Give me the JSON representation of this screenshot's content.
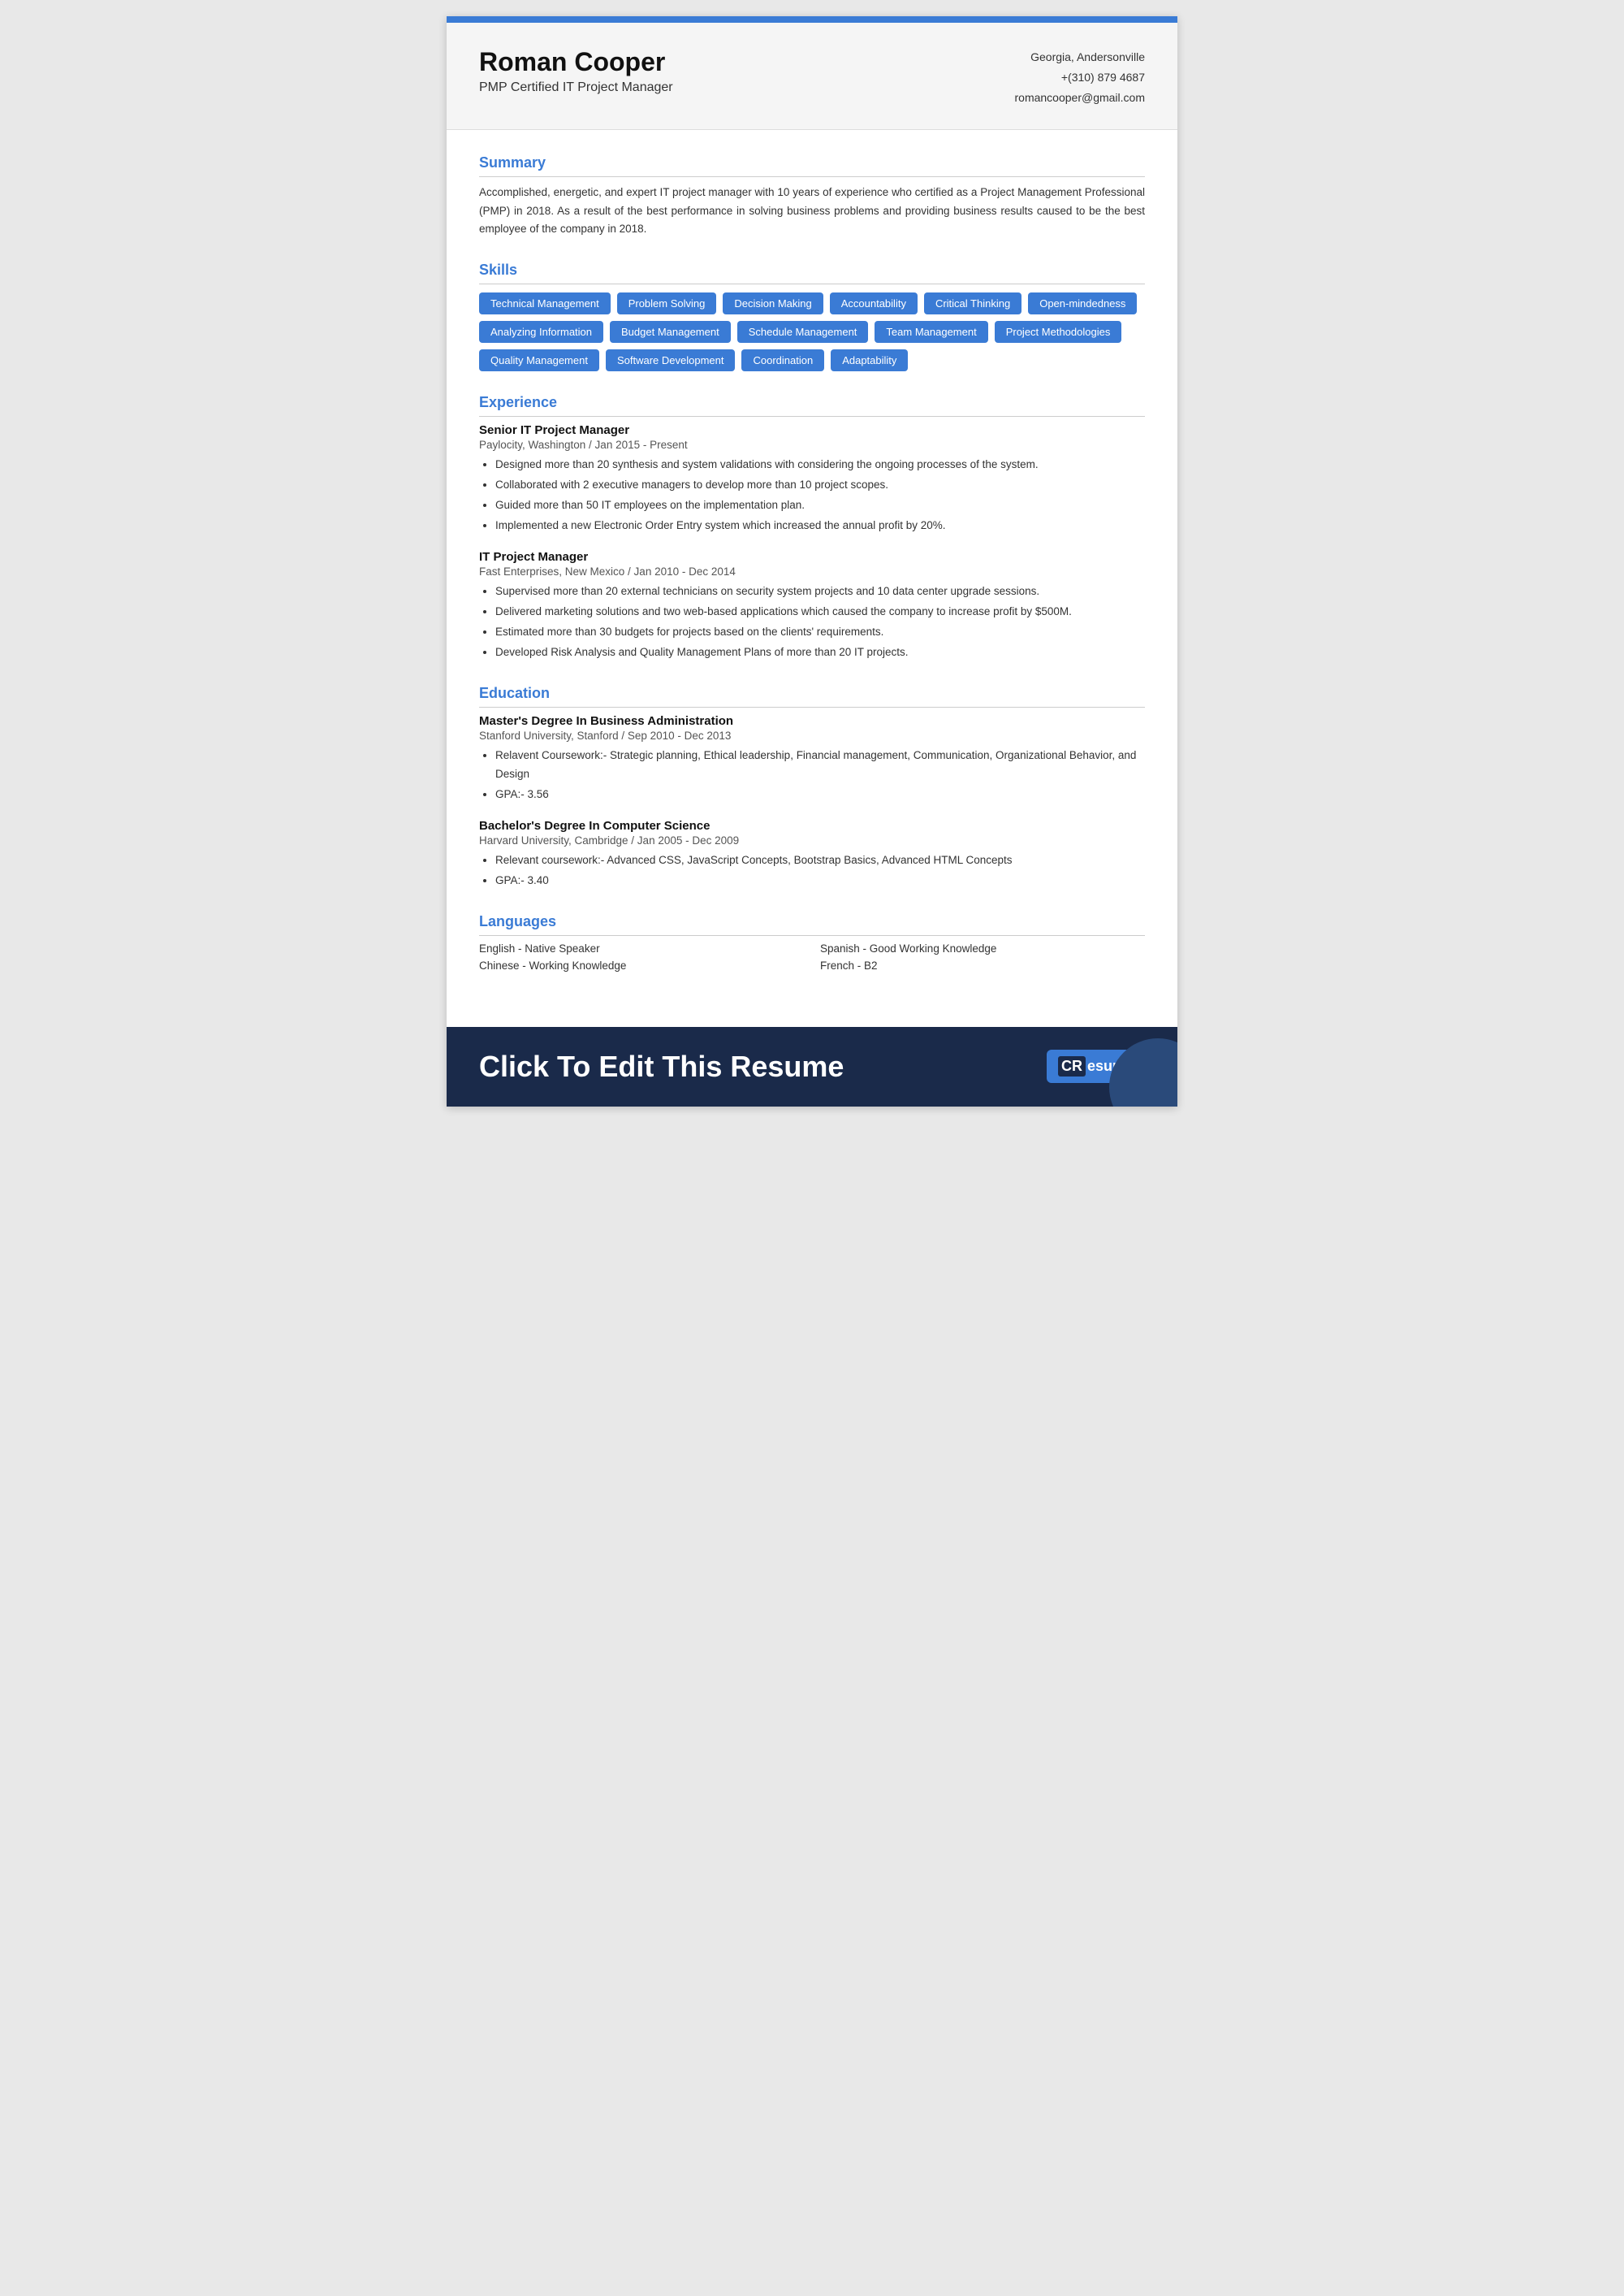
{
  "header": {
    "name": "Roman Cooper",
    "title": "PMP Certified IT Project Manager",
    "location": "Georgia, Andersonville",
    "phone": "+(310) 879 4687",
    "email": "romancooper@gmail.com"
  },
  "summary": {
    "section_title": "Summary",
    "text": "Accomplished, energetic, and expert IT project manager with 10 years of experience who certified as a Project Management Professional (PMP) in 2018. As a result of the best performance in solving business problems and providing business results caused to be the best employee of the company in 2018."
  },
  "skills": {
    "section_title": "Skills",
    "items": [
      "Technical Management",
      "Problem Solving",
      "Decision Making",
      "Accountability",
      "Critical Thinking",
      "Open-mindedness",
      "Analyzing Information",
      "Budget Management",
      "Schedule Management",
      "Team Management",
      "Project Methodologies",
      "Quality Management",
      "Software Development",
      "Coordination",
      "Adaptability"
    ]
  },
  "experience": {
    "section_title": "Experience",
    "jobs": [
      {
        "title": "Senior IT Project Manager",
        "company": "Paylocity, Washington / Jan 2015 - Present",
        "bullets": [
          "Designed more than 20 synthesis and system validations with considering the ongoing processes of the system.",
          "Collaborated with 2 executive managers to develop more than 10 project scopes.",
          "Guided more than 50 IT employees on the implementation plan.",
          "Implemented a new Electronic Order Entry system which increased the annual profit by 20%."
        ]
      },
      {
        "title": "IT Project Manager",
        "company": "Fast Enterprises, New Mexico / Jan 2010 - Dec 2014",
        "bullets": [
          "Supervised more than 20 external technicians on security system projects and 10 data center upgrade sessions.",
          "Delivered marketing solutions and two web-based applications which caused the company to increase profit by $500M.",
          "Estimated more than 30 budgets for projects based on the clients' requirements.",
          "Developed Risk Analysis and Quality Management Plans of more than 20 IT projects."
        ]
      }
    ]
  },
  "education": {
    "section_title": "Education",
    "degrees": [
      {
        "title": "Master's Degree In Business Administration",
        "school": "Stanford University, Stanford / Sep 2010 - Dec 2013",
        "bullets": [
          "Relavent Coursework:- Strategic planning, Ethical leadership, Financial management, Communication, Organizational Behavior, and Design",
          "GPA:- 3.56"
        ]
      },
      {
        "title": "Bachelor's Degree In Computer Science",
        "school": "Harvard University, Cambridge / Jan 2005 - Dec 2009",
        "bullets": [
          "Relevant coursework:- Advanced CSS, JavaScript Concepts,  Bootstrap Basics, Advanced HTML Concepts",
          "GPA:- 3.40"
        ]
      }
    ]
  },
  "languages": {
    "section_title": "Languages",
    "items": [
      "English - Native Speaker",
      "Spanish - Good Working Knowledge",
      "Chinese - Working Knowledge",
      "French - B2"
    ]
  },
  "footer": {
    "cta_text": "Click To Edit This Resume",
    "logo_cr": "CR",
    "logo_text": "esuma"
  }
}
